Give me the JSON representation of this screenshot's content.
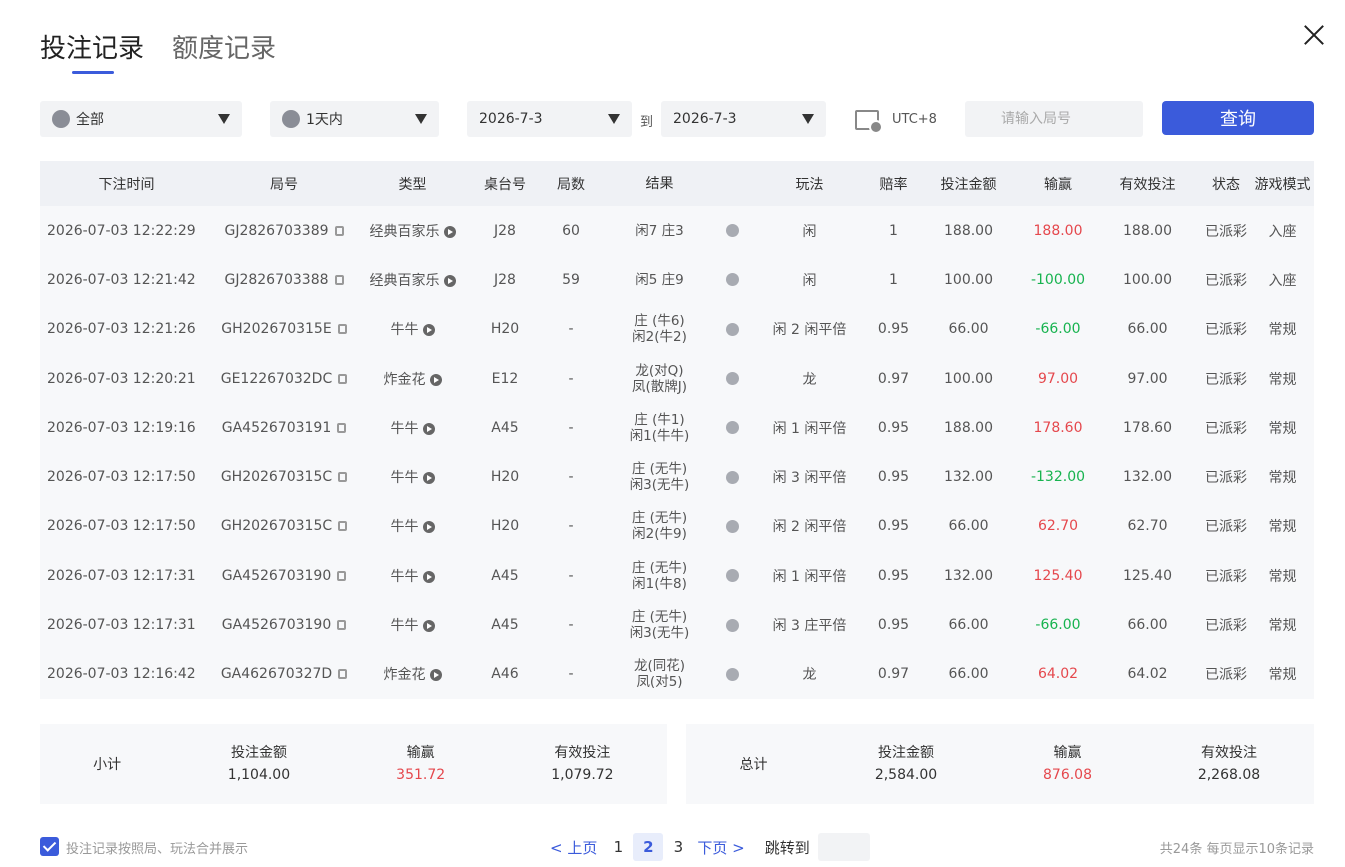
{
  "tabs": [
    {
      "label": "投注记录",
      "active": true
    },
    {
      "label": "额度记录",
      "active": false
    }
  ],
  "filters": {
    "game_type": "全部",
    "time_range": "1天内",
    "date_from": "2026-7-3",
    "date_to_sep": "到",
    "date_to": "2026-7-3",
    "timezone": "UTC+8",
    "round_placeholder": "请输入局号",
    "query_label": "查询"
  },
  "table": {
    "headers": [
      "下注时间",
      "局号",
      "类型",
      "桌台号",
      "局数",
      "结果",
      "",
      "玩法",
      "赔率",
      "投注金额",
      "输赢",
      "有效投注",
      "状态",
      "游戏模式"
    ],
    "rows": [
      {
        "time": "2026-07-03 12:22:29",
        "round": "GJ2826703389",
        "type": "经典百家乐",
        "table": "J28",
        "count": "60",
        "result1": "闲7 庄3",
        "result2": "",
        "play": "闲",
        "odds": "1",
        "bet": "188.00",
        "win": "188.00",
        "win_sign": "pos",
        "valid": "188.00",
        "status": "已派彩",
        "mode": "入座"
      },
      {
        "time": "2026-07-03 12:21:42",
        "round": "GJ2826703388",
        "type": "经典百家乐",
        "table": "J28",
        "count": "59",
        "result1": "闲5 庄9",
        "result2": "",
        "play": "闲",
        "odds": "1",
        "bet": "100.00",
        "win": "-100.00",
        "win_sign": "neg",
        "valid": "100.00",
        "status": "已派彩",
        "mode": "入座"
      },
      {
        "time": "2026-07-03 12:21:26",
        "round": "GH202670315E",
        "type": "牛牛",
        "table": "H20",
        "count": "-",
        "result1": "庄 (牛6)",
        "result2": "闲2(牛2)",
        "play": "闲 2 闲平倍",
        "odds": "0.95",
        "bet": "66.00",
        "win": "-66.00",
        "win_sign": "neg",
        "valid": "66.00",
        "status": "已派彩",
        "mode": "常规"
      },
      {
        "time": "2026-07-03 12:20:21",
        "round": "GE12267032DC",
        "type": "炸金花",
        "table": "E12",
        "count": "-",
        "result1": "龙(对Q)",
        "result2": "凤(散牌J)",
        "play": "龙",
        "odds": "0.97",
        "bet": "100.00",
        "win": "97.00",
        "win_sign": "pos",
        "valid": "97.00",
        "status": "已派彩",
        "mode": "常规"
      },
      {
        "time": "2026-07-03 12:19:16",
        "round": "GA4526703191",
        "type": "牛牛",
        "table": "A45",
        "count": "-",
        "result1": "庄 (牛1)",
        "result2": "闲1(牛牛)",
        "play": "闲 1 闲平倍",
        "odds": "0.95",
        "bet": "188.00",
        "win": "178.60",
        "win_sign": "pos",
        "valid": "178.60",
        "status": "已派彩",
        "mode": "常规"
      },
      {
        "time": "2026-07-03 12:17:50",
        "round": "GH202670315C",
        "type": "牛牛",
        "table": "H20",
        "count": "-",
        "result1": "庄 (无牛)",
        "result2": "闲3(无牛)",
        "play": "闲 3 闲平倍",
        "odds": "0.95",
        "bet": "132.00",
        "win": "-132.00",
        "win_sign": "neg",
        "valid": "132.00",
        "status": "已派彩",
        "mode": "常规"
      },
      {
        "time": "2026-07-03 12:17:50",
        "round": "GH202670315C",
        "type": "牛牛",
        "table": "H20",
        "count": "-",
        "result1": "庄 (无牛)",
        "result2": "闲2(牛9)",
        "play": "闲 2 闲平倍",
        "odds": "0.95",
        "bet": "66.00",
        "win": "62.70",
        "win_sign": "pos",
        "valid": "62.70",
        "status": "已派彩",
        "mode": "常规"
      },
      {
        "time": "2026-07-03 12:17:31",
        "round": "GA4526703190",
        "type": "牛牛",
        "table": "A45",
        "count": "-",
        "result1": "庄 (无牛)",
        "result2": "闲1(牛8)",
        "play": "闲 1 闲平倍",
        "odds": "0.95",
        "bet": "132.00",
        "win": "125.40",
        "win_sign": "pos",
        "valid": "125.40",
        "status": "已派彩",
        "mode": "常规"
      },
      {
        "time": "2026-07-03 12:17:31",
        "round": "GA4526703190",
        "type": "牛牛",
        "table": "A45",
        "count": "-",
        "result1": "庄 (无牛)",
        "result2": "闲3(无牛)",
        "play": "闲 3 庄平倍",
        "odds": "0.95",
        "bet": "66.00",
        "win": "-66.00",
        "win_sign": "neg",
        "valid": "66.00",
        "status": "已派彩",
        "mode": "常规"
      },
      {
        "time": "2026-07-03 12:16:42",
        "round": "GA462670327D",
        "type": "炸金花",
        "table": "A46",
        "count": "-",
        "result1": "龙(同花)",
        "result2": "凤(对5)",
        "play": "龙",
        "odds": "0.97",
        "bet": "66.00",
        "win": "64.02",
        "win_sign": "pos",
        "valid": "64.02",
        "status": "已派彩",
        "mode": "常规"
      }
    ]
  },
  "subtotal": {
    "label": "小计",
    "bet_label": "投注金额",
    "bet": "1,104.00",
    "win_label": "输赢",
    "win": "351.72",
    "valid_label": "有效投注",
    "valid": "1,079.72"
  },
  "total": {
    "label": "总计",
    "bet_label": "投注金额",
    "bet": "2,584.00",
    "win_label": "输赢",
    "win": "876.08",
    "valid_label": "有效投注",
    "valid": "2,268.08"
  },
  "footer": {
    "merge_label": "投注记录按照局、玩法合并展示",
    "prev": "< 上页",
    "pages": [
      "1",
      "2",
      "3"
    ],
    "current_page": "2",
    "next": "下页 >",
    "jump_label": "跳转到",
    "total_info": "共24条  每页显示10条记录"
  },
  "colors": {
    "accent": "#3b5bdb",
    "positive": "#e5484d",
    "negative": "#17b34f"
  }
}
